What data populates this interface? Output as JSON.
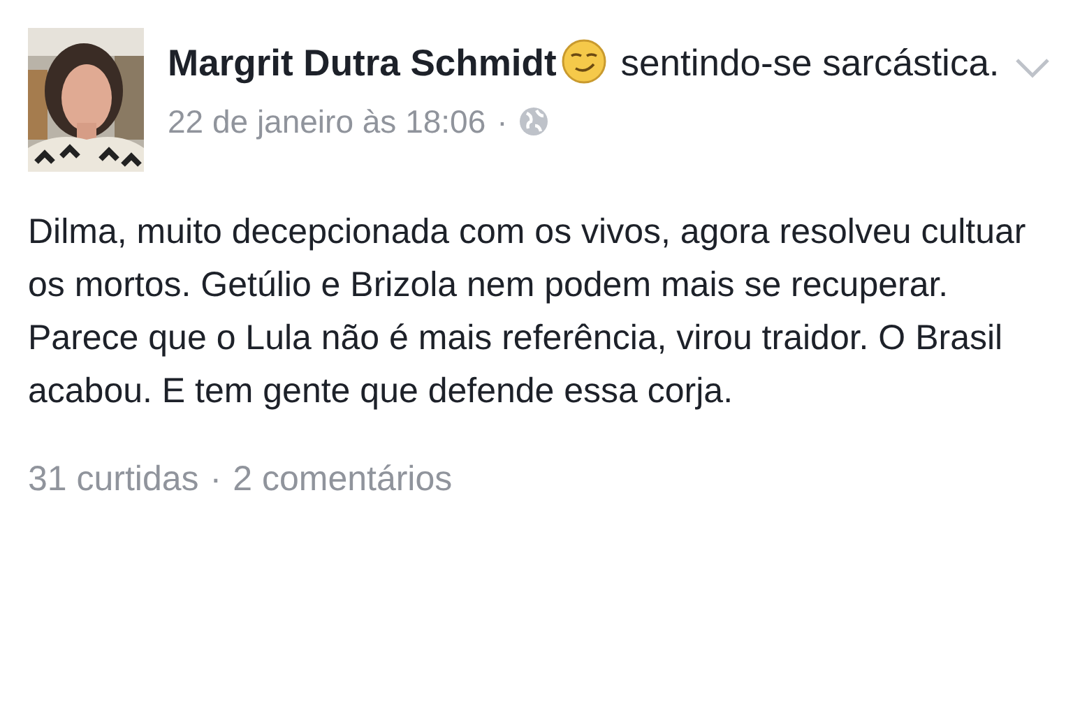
{
  "post": {
    "author": "Margrit Dutra Schmidt",
    "feeling": "sentindo-se sarcástica.",
    "timestamp": "22 de janeiro às 18:06",
    "timestamp_separator": "·",
    "text": "Dilma, muito decepcionada com os vivos, agora resolveu cultuar os mortos. Getúlio e Brizola nem podem mais se recuperar. Parece que o Lula não é mais referência, virou traidor. O Brasil acabou. E tem gente que defende essa corja.",
    "likes": "31 curtidas",
    "counts_separator": "·",
    "comments": "2 comentários"
  }
}
